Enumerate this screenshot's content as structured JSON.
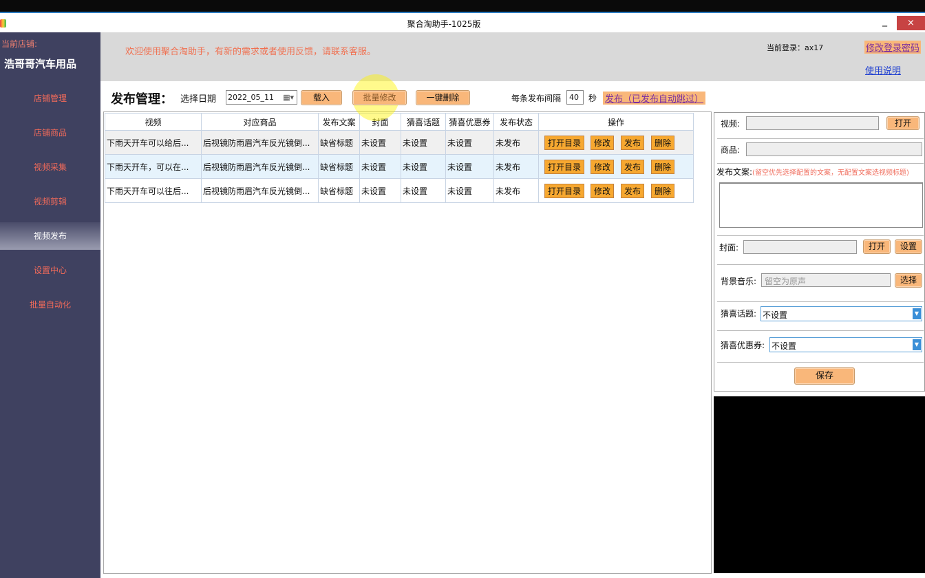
{
  "window": {
    "title": "聚合淘助手-1025版",
    "minimize": "_",
    "close": "×"
  },
  "sidebar": {
    "store_label": "当前店铺:",
    "store_name": "浩哥哥汽车用品",
    "items": [
      {
        "label": "店铺管理"
      },
      {
        "label": "店铺商品"
      },
      {
        "label": "视频采集"
      },
      {
        "label": "视频剪辑"
      },
      {
        "label": "视频发布",
        "active": true
      },
      {
        "label": "设置中心"
      },
      {
        "label": "批量自动化"
      }
    ]
  },
  "header": {
    "welcome": "欢迎使用聚合淘助手，有新的需求或者使用反馈，请联系客服。",
    "login": "当前登录：ax17",
    "change_password": "修改登录密码",
    "help": "使用说明"
  },
  "toolbar": {
    "title": "发布管理：",
    "date_label": "选择日期",
    "date": "2022_05_11",
    "load": "载入",
    "batch_edit": "批量修改",
    "delete_all": "一键删除",
    "interval_label": "每条发布间隔",
    "interval": "40",
    "seconds": "秒",
    "publish": "发布（已发布自动跳过）"
  },
  "table": {
    "columns": [
      "视频",
      "对应商品",
      "发布文案",
      "封面",
      "猜喜话题",
      "猜喜优惠券",
      "发布状态",
      "操作"
    ],
    "rows": [
      [
        "下雨天开车可以给后...",
        "后视镜防雨眉汽车反光镜倒...",
        "缺省标题",
        "未设置",
        "未设置",
        "未设置",
        "未发布"
      ],
      [
        "下雨天开车，可以在...",
        "后视镜防雨眉汽车反光镜倒...",
        "缺省标题",
        "未设置",
        "未设置",
        "未设置",
        "未发布"
      ],
      [
        "下雨天开车可以往后...",
        "后视镜防雨眉汽车反光镜倒...",
        "缺省标题",
        "未设置",
        "未设置",
        "未设置",
        "未发布"
      ]
    ],
    "actions": [
      "打开目录",
      "修改",
      "发布",
      "删除"
    ]
  },
  "panel": {
    "video_label": "视频:",
    "open": "打开",
    "product_label": "商品:",
    "copy_label": "发布文案:",
    "copy_hint": "(留空优先选择配置的文案，无配置文案选视频标题)",
    "cover_label": "封面:",
    "set": "设置",
    "music_label": "背景音乐:",
    "music_placeholder": "留空为原声",
    "choose": "选择",
    "topic_label": "猜喜话题:",
    "topic_value": "不设置",
    "coupon_label": "猜喜优惠券:",
    "coupon_value": "不设置",
    "save": "保存"
  }
}
